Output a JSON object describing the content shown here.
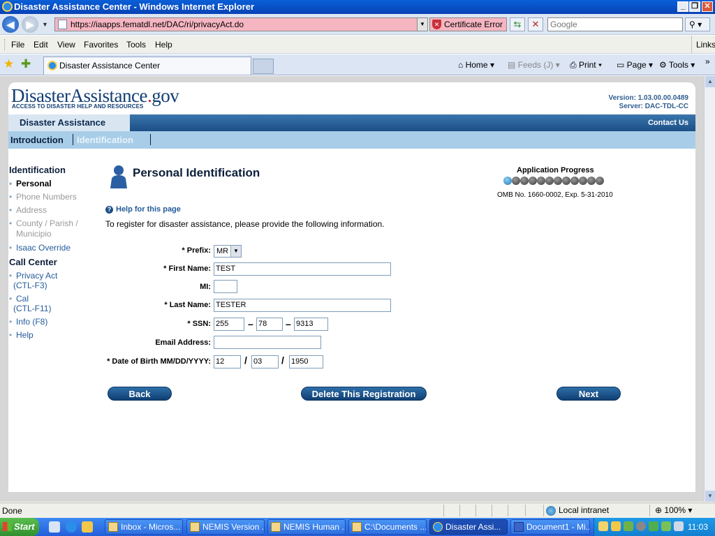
{
  "window": {
    "title": "Disaster Assistance Center - Windows Internet Explorer",
    "minimize": "_",
    "maximize": "❐",
    "close": "✕"
  },
  "address_bar": {
    "url": "https://iaapps.fematdl.net/DAC/ri/privacyAct.do",
    "certificate_error": "Certificate Error",
    "search_placeholder": "Google"
  },
  "menu": {
    "items": [
      "File",
      "Edit",
      "View",
      "Favorites",
      "Tools",
      "Help"
    ],
    "links": "Links"
  },
  "tabs": {
    "active_tab": "Disaster Assistance Center",
    "commands": {
      "home": "Home",
      "feeds": "Feeds (J)",
      "print": "Print",
      "page": "Page",
      "tools": "Tools"
    }
  },
  "site": {
    "logo_text": "DisasterAssistance",
    "logo_dot": ".",
    "logo_gov": "gov",
    "tagline": "ACCESS TO DISASTER HELP AND RESOURCES",
    "version": "Version: 1.03.00.00.0489",
    "server": "Server: DAC-TDL-CC",
    "app_tab": "Disaster Assistance",
    "contact_us": "Contact Us",
    "nav": {
      "introduction": "Introduction",
      "identification": "Identification"
    }
  },
  "sidebar": {
    "identification_head": "Identification",
    "items": [
      "Personal",
      "Phone Numbers",
      "Address",
      "County / Parish / Municipio",
      "Isaac Override"
    ],
    "call_center_head": "Call Center",
    "cc_items": [
      {
        "label": "Privacy Act",
        "sub": "(CTL-F3)"
      },
      {
        "label": "Cal",
        "sub": "(CTL-F11)"
      },
      {
        "label": "Info (F8)",
        "sub": ""
      },
      {
        "label": "Help",
        "sub": ""
      }
    ]
  },
  "main": {
    "title": "Personal Identification",
    "progress_title": "Application Progress",
    "progress": {
      "current_step": 1,
      "total_steps": 12
    },
    "omb": "OMB No. 1660-0002, Exp. 5-31-2010",
    "help_link": "Help for this page",
    "intro": "To register for disaster assistance, please provide the following information."
  },
  "form": {
    "prefix_label": "* Prefix:",
    "prefix_value": "MR",
    "first_name_label": "* First Name:",
    "first_name_value": "TEST",
    "mi_label": "MI:",
    "mi_value": "",
    "last_name_label": "* Last Name:",
    "last_name_value": "TESTER",
    "ssn_label": "* SSN:",
    "ssn_1": "255",
    "ssn_2": "78",
    "ssn_3": "9313",
    "ssn_sep": "–",
    "email_label": "Email Address:",
    "email_value": "",
    "dob_label": "* Date of Birth MM/DD/YYYY:",
    "dob_mm": "12",
    "dob_dd": "03",
    "dob_yyyy": "1950",
    "dob_sep": "/"
  },
  "buttons": {
    "back": "Back",
    "delete": "Delete This Registration",
    "next": "Next"
  },
  "status": {
    "text": "Done",
    "zone": "Local intranet",
    "zoom": "100%"
  },
  "taskbar": {
    "start": "Start",
    "tasks": [
      "Inbox - Micros...",
      "NEMIS Version ...",
      "NEMIS Human ...",
      "C:\\Documents ...",
      "Disaster Assi...",
      "Document1 - Mi..."
    ],
    "clock": "11:03"
  }
}
